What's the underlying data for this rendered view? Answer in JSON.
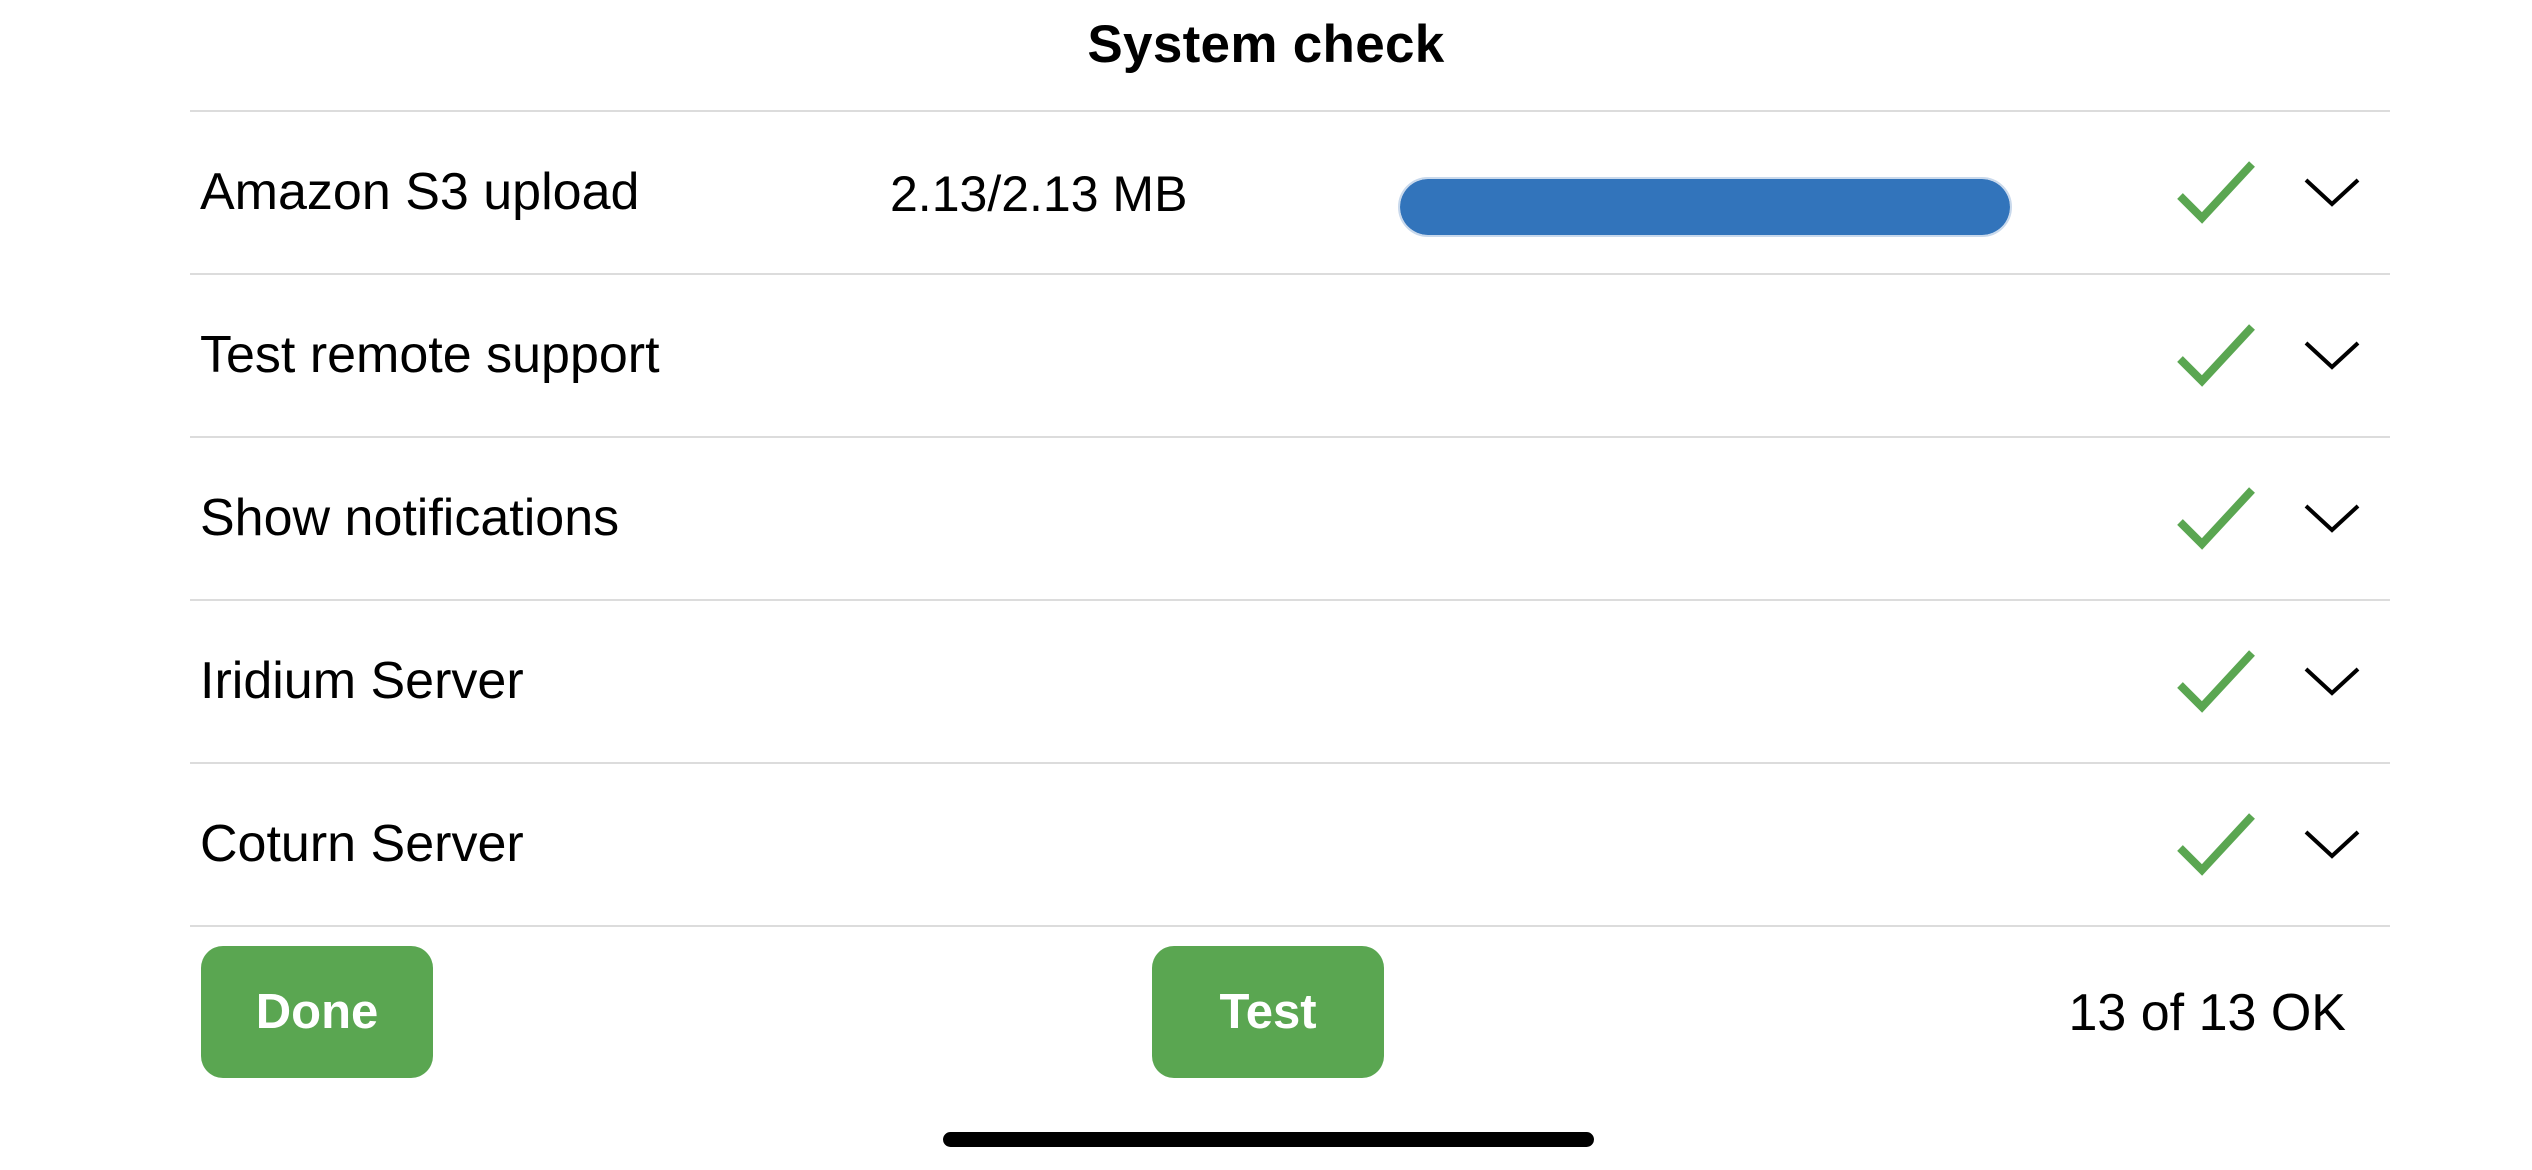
{
  "header": {
    "title": "System check"
  },
  "checks": [
    {
      "label": "Amazon S3 upload",
      "size": "2.13/2.13 MB",
      "progress": 1.0,
      "status_icon": "checkmark-icon",
      "expand_icon": "chevron-down-icon"
    },
    {
      "label": "Test remote support",
      "status_icon": "checkmark-icon",
      "expand_icon": "chevron-down-icon"
    },
    {
      "label": "Show notifications",
      "status_icon": "checkmark-icon",
      "expand_icon": "chevron-down-icon"
    },
    {
      "label": "Iridium Server",
      "status_icon": "checkmark-icon",
      "expand_icon": "chevron-down-icon"
    },
    {
      "label": "Coturn Server",
      "status_icon": "checkmark-icon",
      "expand_icon": "chevron-down-icon"
    }
  ],
  "footer": {
    "done_label": "Done",
    "test_label": "Test",
    "status_text": "13 of 13 OK"
  },
  "colors": {
    "success_green": "#5aa651",
    "progress_blue": "#3274bb",
    "divider": "#dcdcdc"
  }
}
